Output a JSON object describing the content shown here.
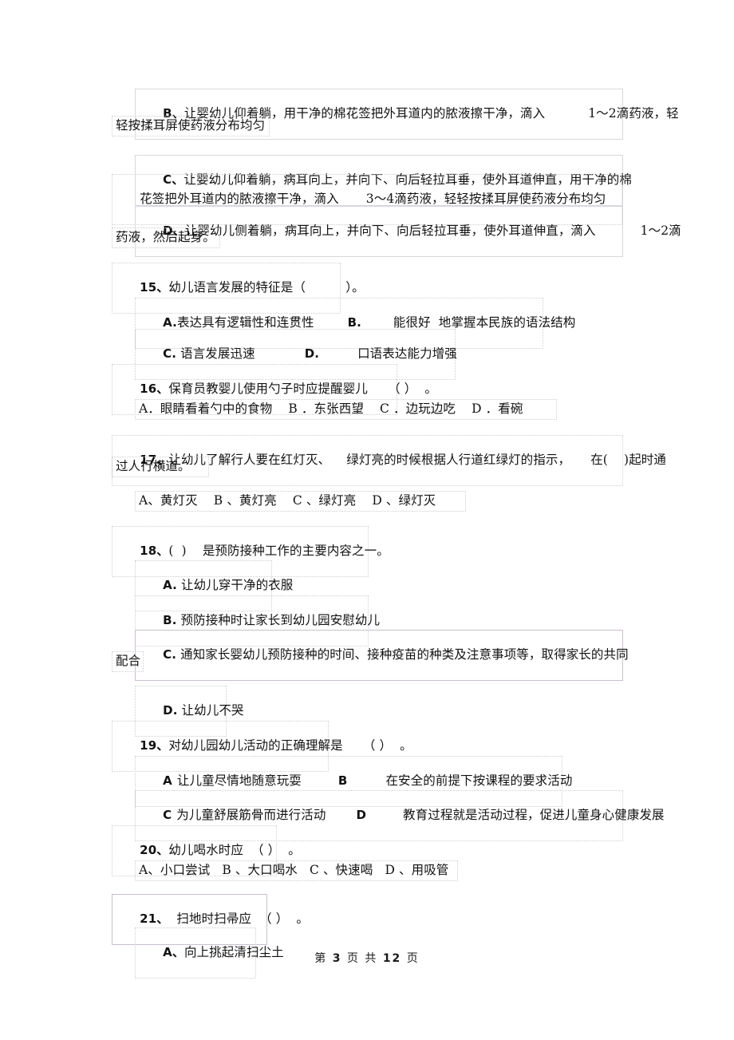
{
  "page": {
    "footer_prefix": "第",
    "footer_current": "3",
    "footer_middle": "页 共",
    "footer_total": "12",
    "footer_suffix": "页",
    "footer_full": "第 3 页 共 12 页"
  },
  "blocks": [
    {
      "id": "q14-option-b",
      "kind": "option",
      "letter": "B、",
      "line1": "让婴幼儿仰着躺，用干净的棉花签把外耳道内的脓液擦干净，滴入",
      "line1_tail": "1～2滴药液，轻",
      "line2": "轻按揉耳屏使药液分布均匀"
    },
    {
      "id": "q14-option-c",
      "kind": "option",
      "letter": "C、",
      "line1": "让婴幼儿仰着躺，病耳向上，并向下、向后轻拉耳垂，使外耳道伸直，用干净的棉",
      "line2": "花签把外耳道内的脓液擦干净，滴入",
      "line2_tail": "3～4滴药液，轻轻按揉耳屏使药液分布均匀"
    },
    {
      "id": "q14-option-d",
      "kind": "option",
      "letter": "D、",
      "line1": "让婴幼儿侧着躺，病耳向上，并向下、向后轻拉耳垂，使外耳道伸直，滴入",
      "line1_tail": "1～2滴",
      "line2": "药液，然后起身。"
    },
    {
      "id": "q15",
      "kind": "question",
      "number": "15、",
      "text": "幼儿语言发展的特征是（          ）。"
    },
    {
      "id": "q15-row1",
      "kind": "option-row",
      "a_letter": "A.",
      "a_text": "表达具有逻辑性和连贯性",
      "b_letter": "B.",
      "b_text": "能很好  地掌握本民族的语法结构"
    },
    {
      "id": "q15-row2",
      "kind": "option-row",
      "a_letter": "C.",
      "a_text": "语言发展迅速",
      "b_letter": "D.",
      "b_text": "口语表达能力增强"
    },
    {
      "id": "q16",
      "kind": "question",
      "number": "16、",
      "text": "保育员教婴儿使用勺子时应提醒婴儿     （ ）  。"
    },
    {
      "id": "q16-options",
      "kind": "option-line",
      "text": "A．眼睛看着勺中的食物    B ．东张西望    C ．边玩边吃    D ．看碗"
    },
    {
      "id": "q17",
      "kind": "question",
      "number": "17、",
      "line1": "让幼儿了解行人要在红灯灭、    绿灯亮的时候根据人行道红绿灯的指示，     在(    )起时通",
      "line2": "过人行横道。"
    },
    {
      "id": "q17-options",
      "kind": "option-line",
      "text": "A、黄灯灭    B 、黄灯亮    C 、绿灯亮    D 、绿灯灭"
    },
    {
      "id": "q18",
      "kind": "question",
      "number": "18、",
      "text": "(  )    是预防接种工作的主要内容之一。"
    },
    {
      "id": "q18-a",
      "kind": "option",
      "letter": "A.",
      "line1": "让幼儿穿干净的衣服"
    },
    {
      "id": "q18-b",
      "kind": "option",
      "letter": "B.",
      "line1": "预防接种时让家长到幼儿园安慰幼儿"
    },
    {
      "id": "q18-c",
      "kind": "option",
      "letter": "C.",
      "line1": "通知家长婴幼儿预防接种的时间、接种疫苗的种类及注意事项等，取得家长的共同",
      "line2": "配合"
    },
    {
      "id": "q18-d",
      "kind": "option",
      "letter": "D.",
      "line1": "让幼儿不哭"
    },
    {
      "id": "q19",
      "kind": "question",
      "number": "19、",
      "text": "对幼儿园幼儿活动的正确理解是     （ ）  。"
    },
    {
      "id": "q19-row1",
      "kind": "option-row",
      "a_letter": "A",
      "a_text": "让儿童尽情地随意玩耍",
      "b_letter": "B",
      "b_text": "在安全的前提下按课程的要求活动"
    },
    {
      "id": "q19-row2",
      "kind": "option-row",
      "a_letter": "C",
      "a_text": "为儿童舒展筋骨而进行活动",
      "b_letter": "D",
      "b_text": "教育过程就是活动过程，促进儿童身心健康发展"
    },
    {
      "id": "q20",
      "kind": "question",
      "number": "20、",
      "text": "幼儿喝水时应  （ ）  。"
    },
    {
      "id": "q20-options",
      "kind": "option-line",
      "text": "A、小口尝试   B 、大口喝水   C 、快速喝   D 、用吸管"
    },
    {
      "id": "q21",
      "kind": "question",
      "number": "21、",
      "text": "  扫地时扫帚应  （ ）  。"
    },
    {
      "id": "q21-a",
      "kind": "option",
      "letter": "A、",
      "line1": "向上挑起清扫尘土"
    }
  ]
}
